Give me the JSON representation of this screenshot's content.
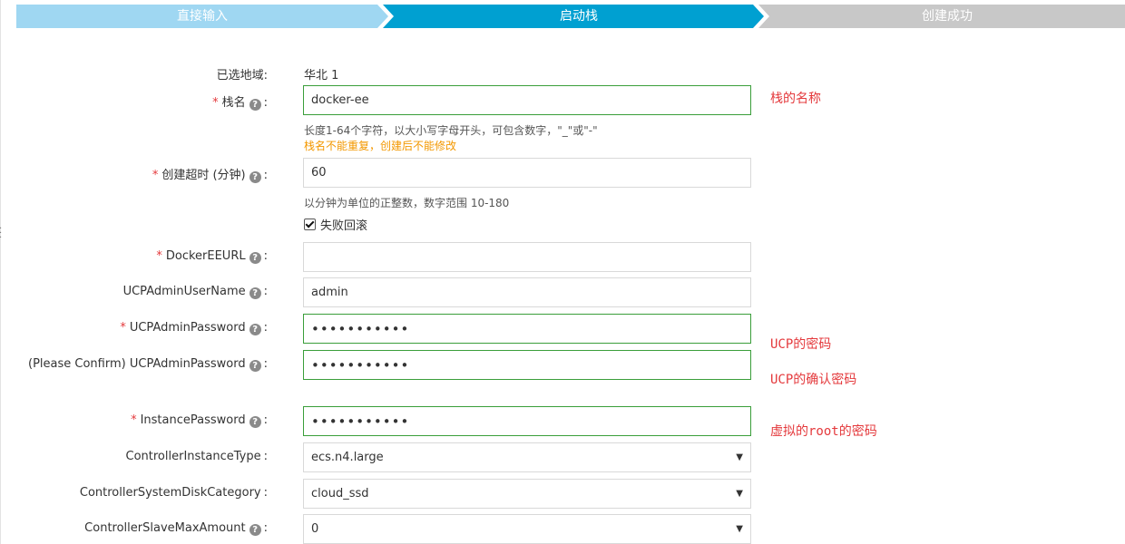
{
  "steps": [
    {
      "label": "直接输入",
      "state": "done"
    },
    {
      "label": "启动栈",
      "state": "active"
    },
    {
      "label": "创建成功",
      "state": "pending"
    }
  ],
  "colors": {
    "done": "#9fd7f2",
    "active": "#00a0d1",
    "pending": "#c8c8c8",
    "required": "#e4393c",
    "valid_border": "#3a9e3a",
    "warn": "#f39800"
  },
  "form": {
    "region": {
      "label": "已选地域:",
      "value": "华北 1"
    },
    "stack_name": {
      "label": "栈名",
      "value": "docker-ee",
      "hint": "长度1-64个字符，以大小写字母开头，可包含数字，\"_\"或\"-\"",
      "warning": "栈名不能重复，创建后不能修改",
      "note": "栈的名称"
    },
    "timeout": {
      "label": "创建超时 (分钟)",
      "value": "60",
      "hint": "以分钟为单位的正整数，数字范围 10-180"
    },
    "rollback": {
      "label": "失败回滚",
      "checked": true
    },
    "docker_ee_url": {
      "label": "DockerEEURL",
      "value": ""
    },
    "ucp_admin_username": {
      "label": "UCPAdminUserName",
      "value": "admin"
    },
    "ucp_admin_password": {
      "label": "UCPAdminPassword",
      "value": "•••••••••••",
      "note": "UCP的密码"
    },
    "ucp_admin_password_confirm": {
      "label": "(Please Confirm) UCPAdminPassword",
      "value": "•••••••••••",
      "note": "UCP的确认密码"
    },
    "instance_password": {
      "label": "InstancePassword",
      "value": "•••••••••••",
      "note": "虚拟的root的密码"
    },
    "controller_instance_type": {
      "label": "ControllerInstanceType",
      "value": "ecs.n4.large"
    },
    "controller_system_disk_category": {
      "label": "ControllerSystemDiskCategory",
      "value": "cloud_ssd"
    },
    "controller_slave_max_amount": {
      "label": "ControllerSlaveMaxAmount",
      "value": "0"
    }
  },
  "icons": {
    "help": "question-circle-icon",
    "dropdown": "caret-down-icon",
    "checkbox": "checkmark-icon"
  }
}
